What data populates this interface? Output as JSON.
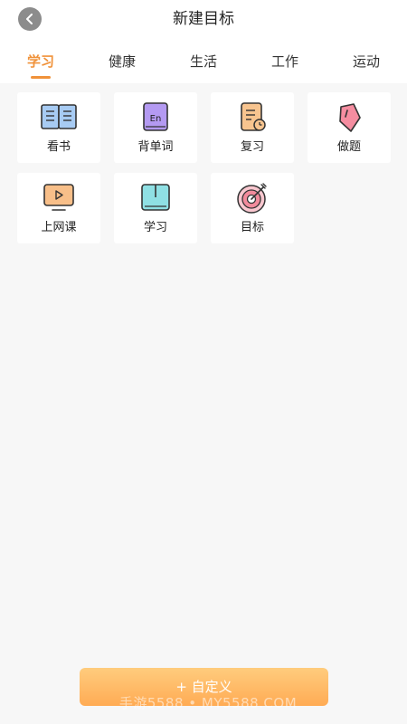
{
  "header": {
    "title": "新建目标",
    "back_icon": "chevron-left-icon"
  },
  "tabs": [
    {
      "label": "学习",
      "active": true
    },
    {
      "label": "健康",
      "active": false
    },
    {
      "label": "生活",
      "active": false
    },
    {
      "label": "工作",
      "active": false
    },
    {
      "label": "运动",
      "active": false
    }
  ],
  "goals": [
    {
      "label": "看书",
      "icon": "open-book-icon"
    },
    {
      "label": "背单词",
      "icon": "english-word-icon"
    },
    {
      "label": "复习",
      "icon": "review-notes-icon"
    },
    {
      "label": "做题",
      "icon": "exercise-tag-icon"
    },
    {
      "label": "上网课",
      "icon": "online-class-icon"
    },
    {
      "label": "学习",
      "icon": "study-book-icon"
    },
    {
      "label": "目标",
      "icon": "target-icon"
    }
  ],
  "footer": {
    "custom_label": "+ 自定义",
    "watermark": "手游5588 • MY5588.COM"
  },
  "colors": {
    "accent": "#f0923a",
    "button_gradient_top": "#ffcc7d",
    "button_gradient_bottom": "#ffab54"
  }
}
